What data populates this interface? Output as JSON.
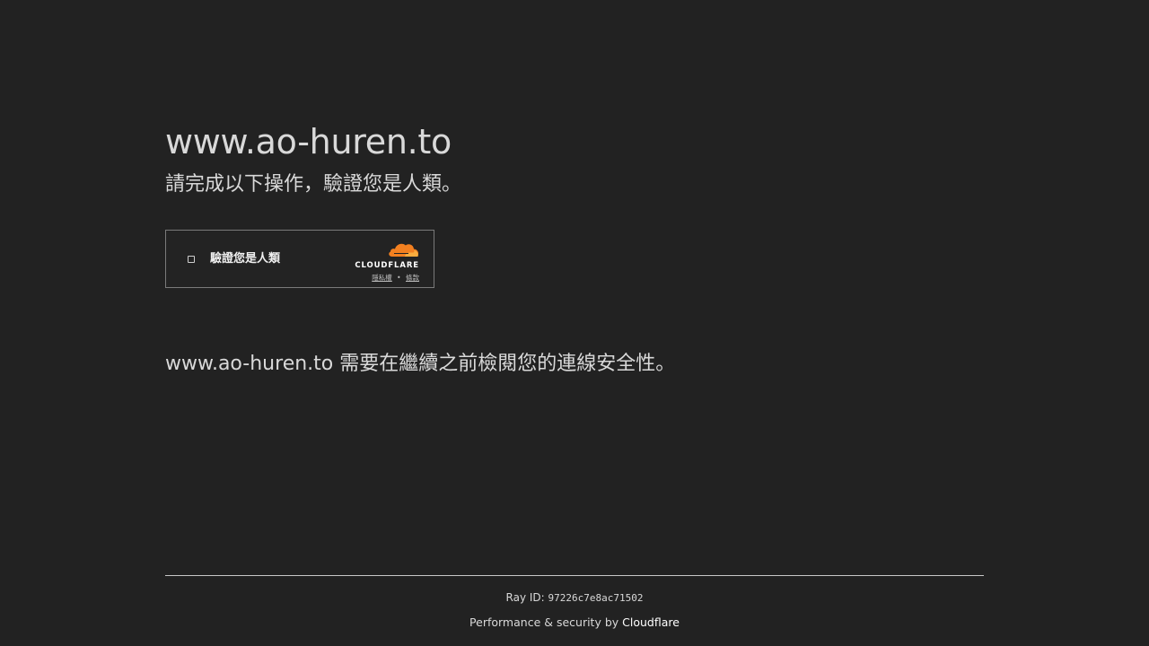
{
  "page": {
    "site_title": "www.ao-huren.to",
    "subtitle": "請完成以下操作，驗證您是人類。",
    "security_message": "www.ao-huren.to 需要在繼續之前檢閱您的連線安全性。"
  },
  "turnstile": {
    "checkbox_label": "驗證您是人類",
    "brand_wordmark": "CLOUDFLARE",
    "privacy_link": "隱私權",
    "separator": "•",
    "terms_link": "條款",
    "cloud_color": "#f38020"
  },
  "footer": {
    "ray_label": "Ray ID:",
    "ray_id": "97226c7e8ac71502",
    "perf_text": "Performance & security by",
    "perf_brand": "Cloudflare"
  }
}
